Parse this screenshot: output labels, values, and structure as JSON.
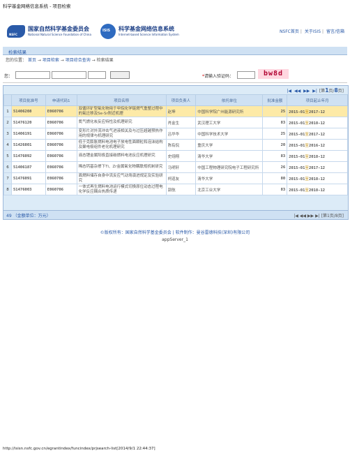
{
  "browser_title": "科学基金网络信息系统 - 项目检索",
  "header": {
    "logo_text": "NSFC",
    "org_name": "国家自然科学基金委员会",
    "org_en": "National Natural Science Foundation of China",
    "isis_logo": "ISIS",
    "sys_name": "科学基金网络信息系统",
    "sys_en": "Internet-based Science Information System",
    "links": [
      "NSFC首页",
      "关于ISIS",
      "留言/信箱"
    ]
  },
  "section_title": "检索结果",
  "breadcrumb": {
    "label": "您的位置：",
    "items": [
      "首页",
      "项目检索",
      "项目综合查询",
      "检索结果"
    ],
    "separator": "→"
  },
  "search": {
    "label": "您：",
    "captcha_label": "请输入验证码：",
    "captcha_required_mark": "*",
    "captcha_text": "bw8d"
  },
  "pager": {
    "icons": [
      "|◀",
      "◀◀",
      "▶▶",
      "▶|"
    ],
    "prefix": "[第",
    "page": "1",
    "middle": "页/",
    "total": "8",
    "suffix": "页]"
  },
  "table": {
    "headers": [
      "项目批准号",
      "申请代码1",
      "项目名称",
      "项目负责人",
      "依托单位",
      "批准金额",
      "项目起止年月"
    ],
    "rows": [
      {
        "idx": "1",
        "app": "51406208",
        "code": "E060706",
        "name": "双循环矿型氧化物用于甲烷化学链燃气重整过程中的氧迁移及Se-Sr附近机理",
        "leader": "赵坤",
        "org": "中国科学院广州能源研究所",
        "amt": "25",
        "start": "2015-01",
        "end": "2017-12",
        "selected": true
      },
      {
        "idx": "2",
        "app": "51476120",
        "code": "E060706",
        "name": "氮气燃化炭反应特性及机理研究",
        "leader": "肖金生",
        "org": "武汉理工大学",
        "amt": "83",
        "start": "2015-01",
        "end": "2018-12",
        "selected": false
      },
      {
        "idx": "3",
        "app": "51406191",
        "code": "E060706",
        "name": "变形片对外流冲击气进液相关及与过压超越预热作用的规律与机理研究",
        "leader": "吕华华",
        "org": "中国科学技术大学",
        "amt": "25",
        "start": "2015-01",
        "end": "2017-12",
        "selected": false
      },
      {
        "idx": "4",
        "app": "51426801",
        "code": "E060706",
        "name": "低于克膨胀燃料电池电子放电性面颗粒和泡沫结构及聚电极组件老化机理研究",
        "leader": "陈有侃",
        "org": "重庆大学",
        "amt": "20",
        "start": "2015-01",
        "end": "2016-12",
        "selected": false
      },
      {
        "idx": "5",
        "app": "51476092",
        "code": "E060706",
        "name": "液态锂金属阳极直接碳燃料电池反应机理研究",
        "leader": "史翊翔",
        "org": "清华大学",
        "amt": "83",
        "start": "2015-01",
        "end": "2018-12",
        "selected": false
      },
      {
        "idx": "6",
        "app": "51406187",
        "code": "E060706",
        "name": "稀态钙基杂掺下Ti、Zr金属氧化物耦联规机制研究",
        "leader": "马明轩",
        "org": "中国工程物理研究院电子工程研究所",
        "amt": "26",
        "start": "2015-01",
        "end": "2017-12",
        "selected": false
      },
      {
        "idx": "7",
        "app": "51476091",
        "code": "E060706",
        "name": "面燃料储存自身中流反应气动场演进规定及实验研究",
        "leader": "柯道友",
        "org": "清华大学",
        "amt": "80",
        "start": "2015-01",
        "end": "2018-12",
        "selected": false
      },
      {
        "idx": "8",
        "app": "51476003",
        "code": "E060706",
        "name": "一体式再生燃料电池运行模式切换原位动态过程电化学反应耦合热质传递",
        "leader": "郭航",
        "org": "北京工业大学",
        "amt": "83",
        "start": "2015-01",
        "end": "2018-12",
        "selected": false
      }
    ],
    "date_sep": "至"
  },
  "footer_bar": {
    "count": "49",
    "unit_label": "（金额单位：万元）"
  },
  "copyright": "©版权所有：国家自然科学基金委员会 | 软件制作：曼谷雷德科技(深圳)有限公司",
  "server": "appServer_1",
  "url": "http://isisn.nsfc.gov.cn/egrantindex/funcindex/prjsearch-list[2014/9/1 22:44:37]"
}
